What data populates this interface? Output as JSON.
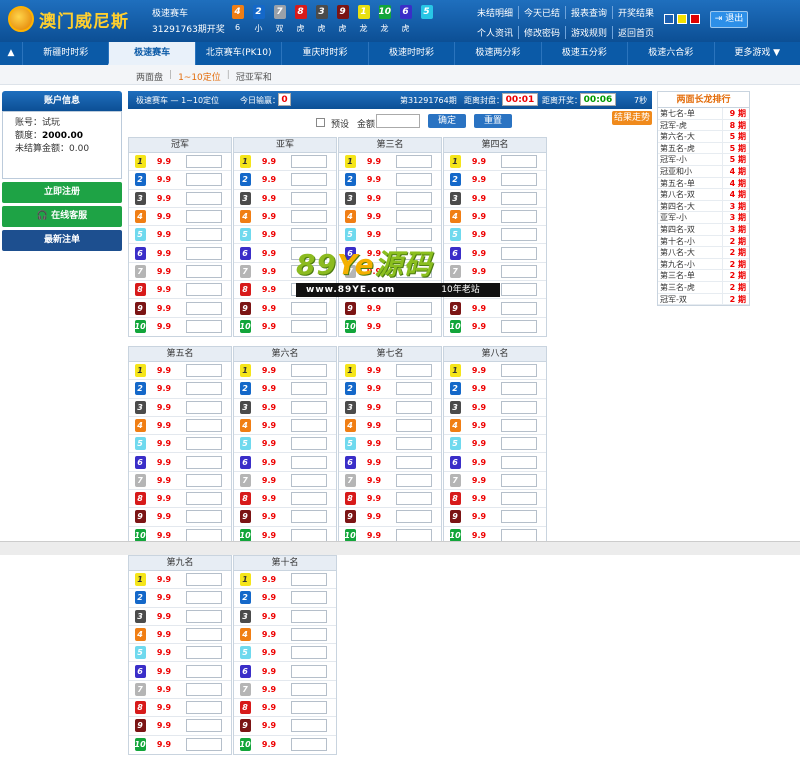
{
  "header": {
    "logo_text": "澳门威尼斯",
    "game_name": "极速赛车",
    "period_text": "31291763期开奖",
    "balls": [
      {
        "num": "4",
        "sub": "6",
        "color": "#f07e14"
      },
      {
        "num": "2",
        "sub": "小",
        "color": "#1468c9"
      },
      {
        "num": "7",
        "sub": "双",
        "color": "#9aa1a9"
      },
      {
        "num": "8",
        "sub": "虎",
        "color": "#d71a1a"
      },
      {
        "num": "3",
        "sub": "虎",
        "color": "#4b4b4b"
      },
      {
        "num": "9",
        "sub": "虎",
        "color": "#7b1414"
      },
      {
        "num": "1",
        "sub": "龙",
        "color": "#e8e010"
      },
      {
        "num": "10",
        "sub": "龙",
        "color": "#12a53a"
      },
      {
        "num": "6",
        "sub": "虎",
        "color": "#3a2ec8"
      },
      {
        "num": "5",
        "sub": "",
        "color": "#28c6e6"
      }
    ],
    "nav": [
      "未结明细",
      "今天已结",
      "报表查询",
      "开奖结果",
      "个人资讯",
      "修改密码",
      "游戏规则",
      "返回首页"
    ],
    "swatch_colors": [
      "#1d5fb0",
      "#f4e000",
      "#e00000"
    ],
    "logout_label": "退出"
  },
  "gamenav": {
    "arrow": "▲",
    "items": [
      "新疆时时彩",
      "极速赛车",
      "北京赛车(PK10)",
      "重庆时时彩",
      "极速时时彩",
      "极速两分彩",
      "极速五分彩",
      "极速六合彩",
      "更多游戏 ▼"
    ],
    "active_index": 1
  },
  "subnav": {
    "items": [
      "两面盘",
      "1~10定位",
      "冠亚军和"
    ],
    "active_index": 1
  },
  "account": {
    "title": "账户信息",
    "account_label": "账号：",
    "account_value": "试玩",
    "quota_label": "额度：",
    "quota_value": "2000.00",
    "unsettled_label": "未结算金额：",
    "unsettled_value": "0.00",
    "btn_bet": "立即注册",
    "btn_service": "在线客服",
    "btn_latest": "最新注单"
  },
  "status": {
    "game": "极速赛车 — 1~10定位",
    "today_label": "今日输赢：",
    "today_value": "0",
    "period": "第31291764期",
    "close_label": "距离封盘：",
    "close_value": "00:01",
    "open_label": "距离开奖：",
    "open_value": "00:06",
    "seconds": "7秒"
  },
  "controls": {
    "preset_label": "预设",
    "amount_label": "金额",
    "confirm": "确定",
    "reset": "重置",
    "trend": "结果走势"
  },
  "odds": "9.9",
  "positions_top": [
    "冠军",
    "亚军",
    "第三名",
    "第四名",
    "第五名"
  ],
  "positions_bottom": [
    "第六名",
    "第七名",
    "第八名",
    "第九名",
    "第十名"
  ],
  "numbers": [
    {
      "n": "1",
      "color": "#f5e51a",
      "fg": "#333"
    },
    {
      "n": "2",
      "color": "#1468c9",
      "fg": "#fff"
    },
    {
      "n": "3",
      "color": "#4b4b4b",
      "fg": "#fff"
    },
    {
      "n": "4",
      "color": "#f07e14",
      "fg": "#fff"
    },
    {
      "n": "5",
      "color": "#6fd9ee",
      "fg": "#fff"
    },
    {
      "n": "6",
      "color": "#3a2ec8",
      "fg": "#fff"
    },
    {
      "n": "7",
      "color": "#b5b5b5",
      "fg": "#fff"
    },
    {
      "n": "8",
      "color": "#d71a1a",
      "fg": "#fff"
    },
    {
      "n": "9",
      "color": "#7b1414",
      "fg": "#fff"
    },
    {
      "n": "10",
      "color": "#12a53a",
      "fg": "#fff"
    }
  ],
  "longdragon": {
    "title": "两面长龙排行",
    "rows": [
      {
        "label": "第七名-单",
        "value": "9 期"
      },
      {
        "label": "冠军-虎",
        "value": "8 期"
      },
      {
        "label": "第六名-大",
        "value": "5 期"
      },
      {
        "label": "第五名-虎",
        "value": "5 期"
      },
      {
        "label": "冠军-小",
        "value": "5 期"
      },
      {
        "label": "冠亚和小",
        "value": "4 期"
      },
      {
        "label": "第五名-单",
        "value": "4 期"
      },
      {
        "label": "第八名-双",
        "value": "4 期"
      },
      {
        "label": "第四名-大",
        "value": "3 期"
      },
      {
        "label": "亚军-小",
        "value": "3 期"
      },
      {
        "label": "第四名-双",
        "value": "3 期"
      },
      {
        "label": "第十名-小",
        "value": "2 期"
      },
      {
        "label": "第八名-大",
        "value": "2 期"
      },
      {
        "label": "第九名-小",
        "value": "2 期"
      },
      {
        "label": "第三名-单",
        "value": "2 期"
      },
      {
        "label": "第三名-虎",
        "value": "2 期"
      },
      {
        "label": "冠军-双",
        "value": "2 期"
      }
    ]
  },
  "watermark": {
    "main_a": "89",
    "main_b": "Ye",
    "main_c": "源码",
    "url": "www.89YE.com",
    "slogan": "10年老站"
  }
}
